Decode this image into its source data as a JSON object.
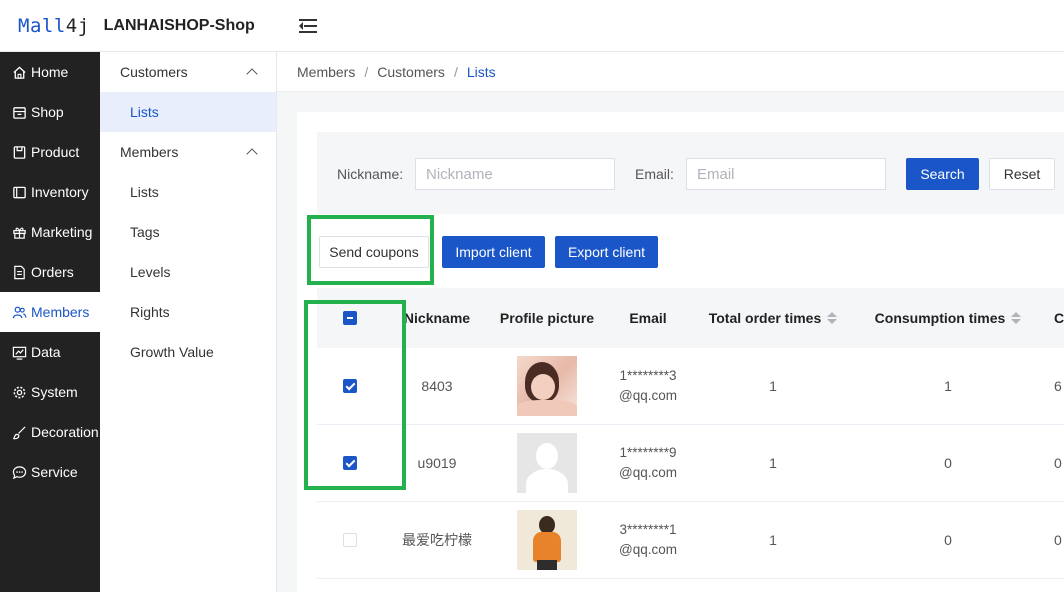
{
  "header": {
    "logo": {
      "main": "Mall",
      "suffix": "4j"
    },
    "shop_name": "LANHAISHOP-Shop"
  },
  "sidebar": {
    "items": [
      {
        "label": "Home",
        "icon": "home-icon"
      },
      {
        "label": "Shop",
        "icon": "shop-icon"
      },
      {
        "label": "Product",
        "icon": "product-icon"
      },
      {
        "label": "Inventory",
        "icon": "inventory-icon"
      },
      {
        "label": "Marketing",
        "icon": "gift-icon"
      },
      {
        "label": "Orders",
        "icon": "orders-icon"
      },
      {
        "label": "Members",
        "icon": "members-icon",
        "active": true
      },
      {
        "label": "Data",
        "icon": "chart-icon"
      },
      {
        "label": "System",
        "icon": "gear-icon"
      },
      {
        "label": "Decoration",
        "icon": "brush-icon"
      },
      {
        "label": "Service",
        "icon": "chat-icon"
      }
    ]
  },
  "submenu": {
    "group1": {
      "label": "Customers",
      "items": [
        "Lists"
      ]
    },
    "group2": {
      "label": "Members",
      "items": [
        "Lists",
        "Tags",
        "Levels",
        "Rights",
        "Growth Value"
      ]
    }
  },
  "breadcrumb": [
    "Members",
    "Customers",
    "Lists"
  ],
  "search": {
    "nickname_label": "Nickname:",
    "nickname_placeholder": "Nickname",
    "email_label": "Email:",
    "email_placeholder": "Email",
    "search_button": "Search",
    "reset_button": "Reset"
  },
  "actions": {
    "send_coupons": "Send coupons",
    "import_client": "Import client",
    "export_client": "Export client"
  },
  "table": {
    "columns": {
      "nickname": "Nickname",
      "profile_picture": "Profile picture",
      "email": "Email",
      "total_order_times": "Total order times",
      "consumption_times": "Consumption times",
      "more": "C"
    },
    "rows": [
      {
        "nickname": "8403",
        "email": "1********3@qq.com",
        "total": "1",
        "consumption": "1",
        "more": "6",
        "checked": true
      },
      {
        "nickname": "u9019",
        "email": "1********9@qq.com",
        "total": "1",
        "consumption": "0",
        "more": "0",
        "checked": true
      },
      {
        "nickname": "最爱吃柠檬",
        "email": "3********1@qq.com",
        "total": "1",
        "consumption": "0",
        "more": "0",
        "checked": false
      }
    ]
  },
  "colors": {
    "primary": "#1a56c8",
    "sidebar_bg": "#222222",
    "highlight": "#22b14c"
  }
}
